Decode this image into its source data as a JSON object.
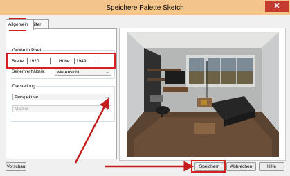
{
  "window": {
    "title": "Speichere Palette Sketch",
    "close_glyph": "✕"
  },
  "tabs": [
    {
      "label": "Allgemein"
    },
    {
      "label": "Filter"
    }
  ],
  "size_group": {
    "label": "Größe in Pixel",
    "width_label": "Breite:",
    "width_value": "1920",
    "height_label": "Höhe:",
    "height_value": "1949",
    "aspect_label": "Seitenverhältnis:",
    "aspect_value": "wie Ansicht"
  },
  "display_group": {
    "label": "Darstellung",
    "mode_value": "Perspektive",
    "marker_value": "Marker"
  },
  "buttons": {
    "preview": "Vorschau",
    "save": "Speichern",
    "cancel": "Abbrechen",
    "help": "Hilfe"
  },
  "colors": {
    "titlebar": "#f3c58d",
    "close": "#c63b2f",
    "highlight": "#d32020"
  }
}
